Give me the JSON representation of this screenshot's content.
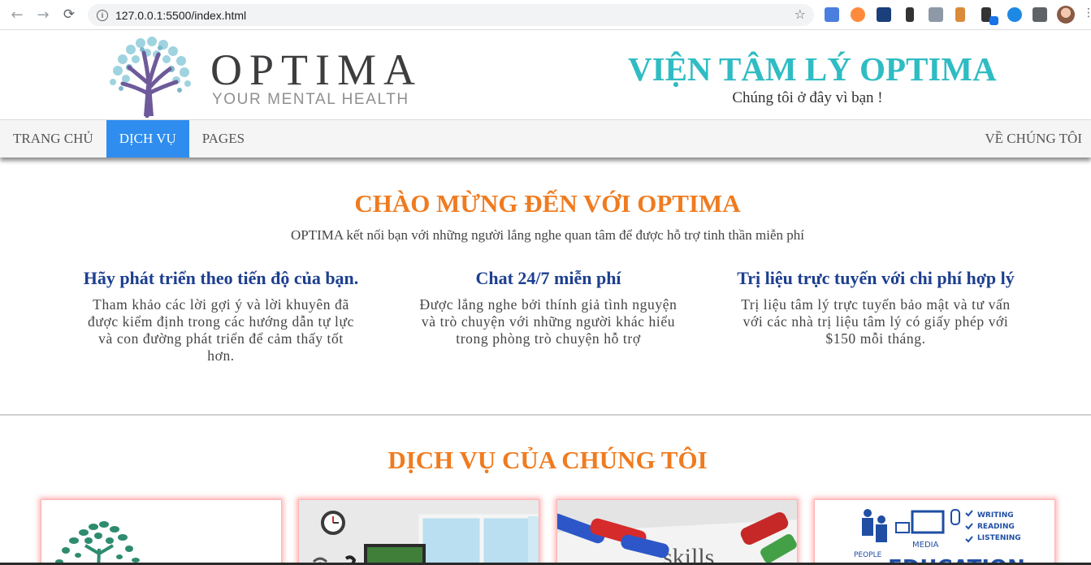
{
  "browser": {
    "url": "127.0.0.1:5500/index.html"
  },
  "header": {
    "brand_name": "OPTIMA",
    "brand_tagline": "YOUR MENTAL HEALTH",
    "institute_title": "VIỆN TÂM LÝ OPTIMA",
    "institute_subtitle": "Chúng tôi ở đây vì bạn !"
  },
  "nav": {
    "items": [
      {
        "label": "TRANG CHỦ",
        "active": false
      },
      {
        "label": "DỊCH VỤ",
        "active": true
      },
      {
        "label": "PAGES",
        "active": false
      }
    ],
    "right_item": "VỀ CHÚNG TÔI"
  },
  "welcome": {
    "title": "CHÀO MỪNG ĐẾN VỚI OPTIMA",
    "subtitle": "OPTIMA kết nối bạn với những người lắng nghe quan tâm để được hỗ trợ tinh thần miễn phí"
  },
  "features": [
    {
      "title": "Hãy phát triển theo tiến độ của bạn.",
      "text": "Tham khảo các lời gợi ý và lời khuyên đã được kiểm định trong các hướng dẫn tự lực và con đường phát triển để cảm thấy tốt hơn."
    },
    {
      "title": "Chat 24/7 miễn phí",
      "text": "Được lắng nghe bởi thính giả tình nguyện và trò chuyện với những người khác hiểu trong phòng trò chuyện hỗ trợ"
    },
    {
      "title": "Trị liệu trực tuyến với chi phí hợp lý",
      "text": "Trị liệu tâm lý trực tuyến bảo mật và tư vấn với các nhà trị liệu tâm lý có giấy phép với $150 mỗi tháng."
    }
  ],
  "services": {
    "title": "DỊCH VỤ CỦA CHÚNG TÔI",
    "card4_labels": {
      "writing": "WRITING",
      "reading": "READING",
      "listening": "LISTENING",
      "media": "MEDIA",
      "people": "PEOPLE",
      "big": "EDUCATION"
    },
    "card3_word": "skills"
  },
  "colors": {
    "accent_orange": "#f07b1f",
    "teal": "#2fbcc3",
    "nav_active": "#2e8def",
    "feature_title": "#1d3f8f"
  }
}
